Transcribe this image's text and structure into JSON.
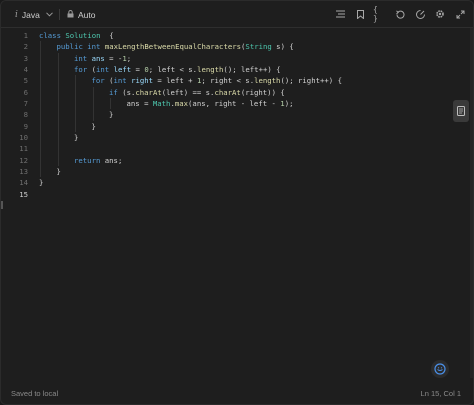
{
  "toolbar": {
    "language": "Java",
    "mode": "Auto",
    "icons": [
      "format-icon",
      "bookmark-icon",
      "braces-icon",
      "reset-icon",
      "run-icon",
      "settings-icon",
      "expand-icon"
    ]
  },
  "code": {
    "active_line": 15,
    "lines": [
      {
        "n": "1",
        "indent": 0,
        "parts": [
          [
            "kw",
            "class "
          ],
          [
            "ty",
            "Solution"
          ],
          [
            "",
            "  {"
          ]
        ]
      },
      {
        "n": "2",
        "indent": 1,
        "parts": [
          [
            "kw",
            "public int "
          ],
          [
            "fn",
            "maxLengthBetweenEqualCharacters"
          ],
          [
            "",
            "("
          ],
          [
            "ty",
            "String"
          ],
          [
            "",
            " s) {"
          ]
        ]
      },
      {
        "n": "3",
        "indent": 2,
        "parts": [
          [
            "kw",
            "int "
          ],
          [
            "vr",
            "ans"
          ],
          [
            "",
            " = -"
          ],
          [
            "nm",
            "1"
          ],
          [
            "",
            ";"
          ]
        ]
      },
      {
        "n": "4",
        "indent": 2,
        "parts": [
          [
            "kw",
            "for "
          ],
          [
            "",
            "("
          ],
          [
            "kw",
            "int "
          ],
          [
            "vr",
            "left"
          ],
          [
            "",
            " = "
          ],
          [
            "nm",
            "0"
          ],
          [
            "",
            "; left < s."
          ],
          [
            "fn",
            "length"
          ],
          [
            "",
            "(); left++) {"
          ]
        ]
      },
      {
        "n": "5",
        "indent": 3,
        "parts": [
          [
            "kw",
            "for "
          ],
          [
            "",
            "("
          ],
          [
            "kw",
            "int "
          ],
          [
            "vr",
            "right"
          ],
          [
            "",
            " = left + "
          ],
          [
            "nm",
            "1"
          ],
          [
            "",
            "; right < s."
          ],
          [
            "fn",
            "length"
          ],
          [
            "",
            "(); right++) {"
          ]
        ]
      },
      {
        "n": "6",
        "indent": 4,
        "parts": [
          [
            "kw",
            "if "
          ],
          [
            "",
            "(s."
          ],
          [
            "fn",
            "charAt"
          ],
          [
            "",
            "(left) == s."
          ],
          [
            "fn",
            "charAt"
          ],
          [
            "",
            "(right)) {"
          ]
        ]
      },
      {
        "n": "7",
        "indent": 5,
        "parts": [
          [
            "",
            "ans = "
          ],
          [
            "ty",
            "Math"
          ],
          [
            "",
            "."
          ],
          [
            "fn",
            "max"
          ],
          [
            "",
            "(ans, right - left - "
          ],
          [
            "nm",
            "1"
          ],
          [
            "",
            ");"
          ]
        ]
      },
      {
        "n": "8",
        "indent": 4,
        "parts": [
          [
            "",
            "}"
          ]
        ]
      },
      {
        "n": "9",
        "indent": 3,
        "parts": [
          [
            "",
            "}"
          ]
        ]
      },
      {
        "n": "10",
        "indent": 2,
        "parts": [
          [
            "",
            "}"
          ]
        ]
      },
      {
        "n": "11",
        "indent": 2,
        "parts": [
          [
            "",
            ""
          ]
        ]
      },
      {
        "n": "12",
        "indent": 2,
        "parts": [
          [
            "kw",
            "return "
          ],
          [
            "",
            "ans;"
          ]
        ]
      },
      {
        "n": "13",
        "indent": 1,
        "parts": [
          [
            "",
            "}"
          ]
        ]
      },
      {
        "n": "14",
        "indent": 0,
        "parts": [
          [
            "",
            "}"
          ]
        ]
      },
      {
        "n": "15",
        "indent": 0,
        "parts": [
          [
            "",
            ""
          ]
        ]
      }
    ]
  },
  "status": {
    "saved": "Saved to local",
    "cursor": "Ln 15, Col 1"
  }
}
